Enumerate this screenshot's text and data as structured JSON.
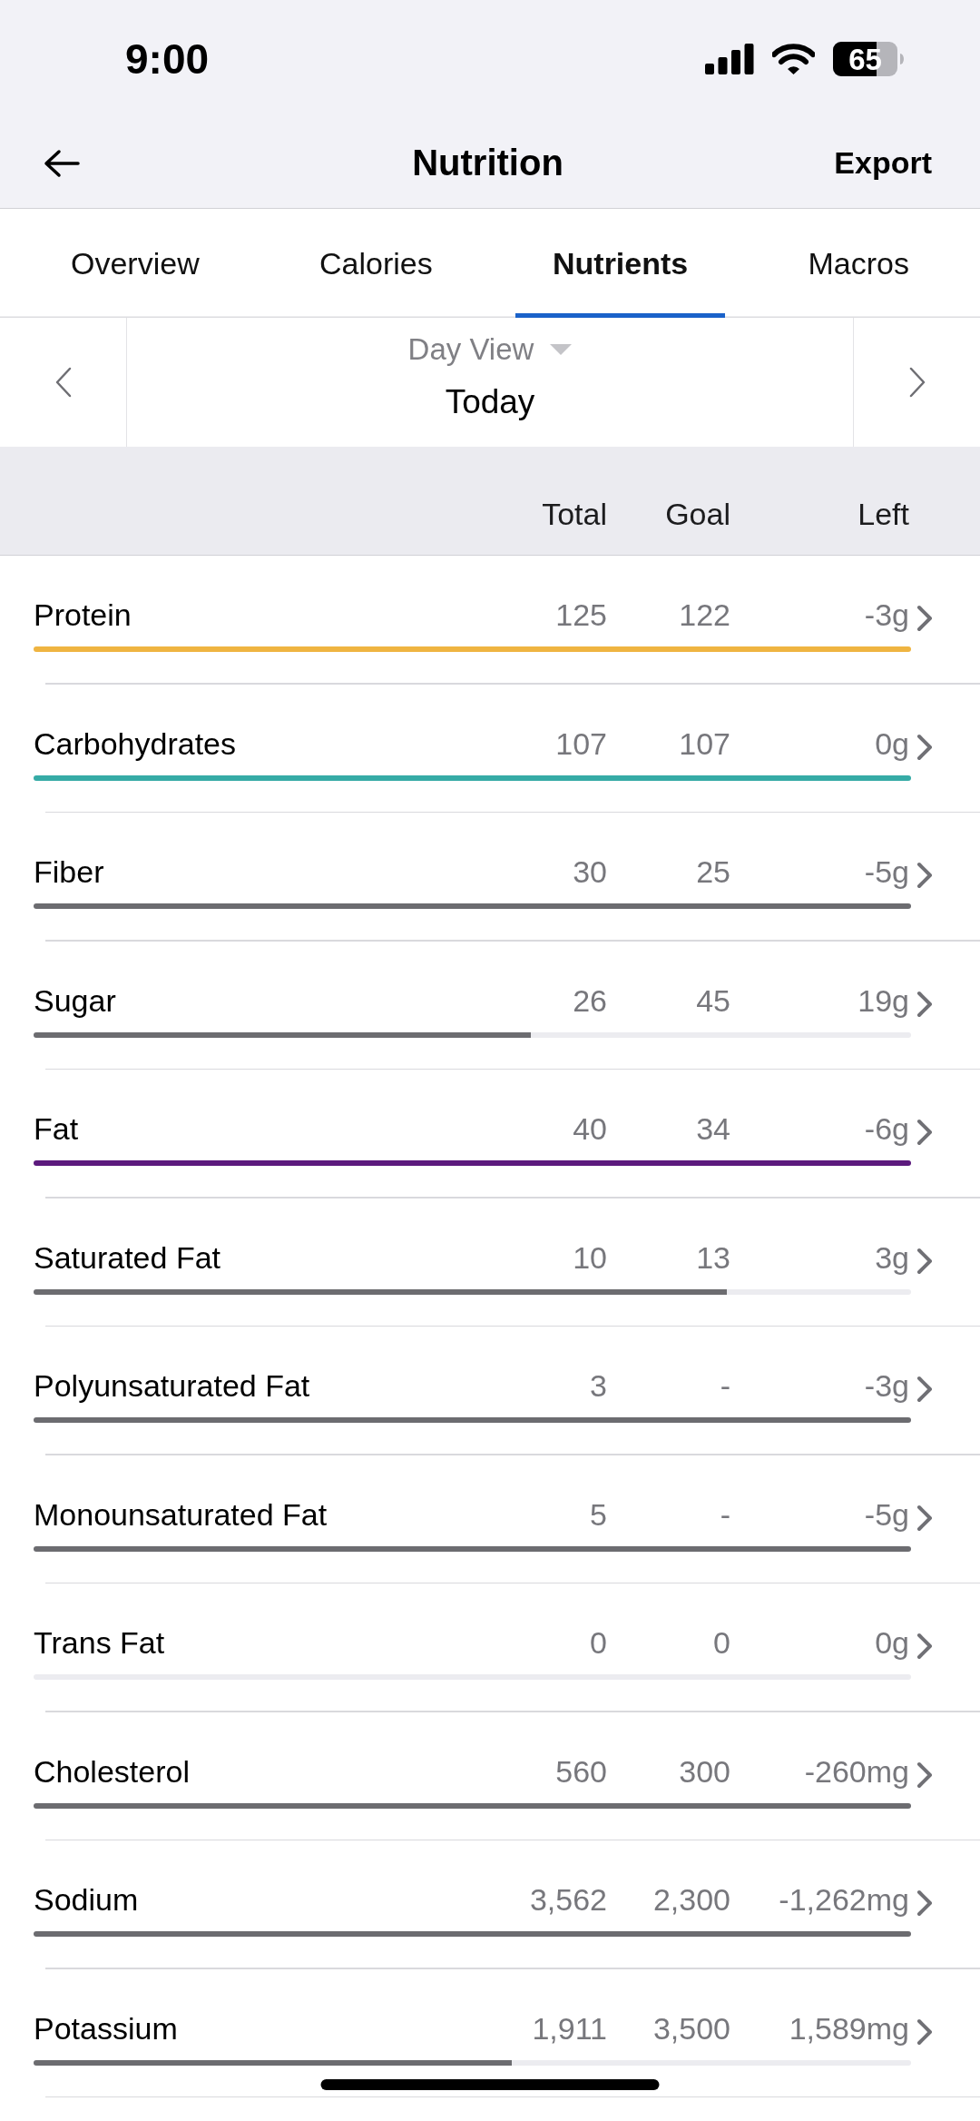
{
  "status_bar": {
    "time": "9:00",
    "battery": "65"
  },
  "nav_bar": {
    "title": "Nutrition",
    "action": "Export"
  },
  "tabs": [
    {
      "label": "Overview",
      "selected": false
    },
    {
      "label": "Calories",
      "selected": false
    },
    {
      "label": "Nutrients",
      "selected": true
    },
    {
      "label": "Macros",
      "selected": false
    }
  ],
  "date_selector": {
    "view": "Day View",
    "date": "Today"
  },
  "table": {
    "columns": [
      "Total",
      "Goal",
      "Left"
    ],
    "rows": [
      {
        "name": "Protein",
        "total": "125",
        "goal": "122",
        "left": "-3g",
        "level": 1,
        "color": "#efb441"
      },
      {
        "name": "Carbohydrates",
        "total": "107",
        "goal": "107",
        "left": "0g",
        "level": 1,
        "color": "#36aba6"
      },
      {
        "name": "Fiber",
        "total": "30",
        "goal": "25",
        "left": "-5g",
        "level": 1,
        "color": "#6c6c70"
      },
      {
        "name": "Sugar",
        "total": "26",
        "goal": "45",
        "left": "19g",
        "level": 0.567,
        "color": "#6c6c70"
      },
      {
        "name": "Fat",
        "total": "40",
        "goal": "34",
        "left": "-6g",
        "level": 1,
        "color": "#5c1a7d"
      },
      {
        "name": "Saturated Fat",
        "total": "10",
        "goal": "13",
        "left": "3g",
        "level": 0.79,
        "color": "#6c6c70"
      },
      {
        "name": "Polyunsaturated Fat",
        "total": "3",
        "goal": "-",
        "left": "-3g",
        "level": 1,
        "color": "#6c6c70"
      },
      {
        "name": "Monounsaturated Fat",
        "total": "5",
        "goal": "-",
        "left": "-5g",
        "level": 1,
        "color": "#6c6c70"
      },
      {
        "name": "Trans Fat",
        "total": "0",
        "goal": "0",
        "left": "0g"
      },
      {
        "name": "Cholesterol",
        "total": "560",
        "goal": "300",
        "left": "-260mg",
        "level": 1,
        "color": "#6c6c70"
      },
      {
        "name": "Sodium",
        "total": "3,562",
        "goal": "2,300",
        "left": "-1,262mg",
        "level": 1,
        "color": "#6c6c70"
      },
      {
        "name": "Potassium",
        "total": "1,911",
        "goal": "3,500",
        "left": "1,589mg",
        "level": 0.545,
        "color": "#6c6c70"
      }
    ]
  }
}
